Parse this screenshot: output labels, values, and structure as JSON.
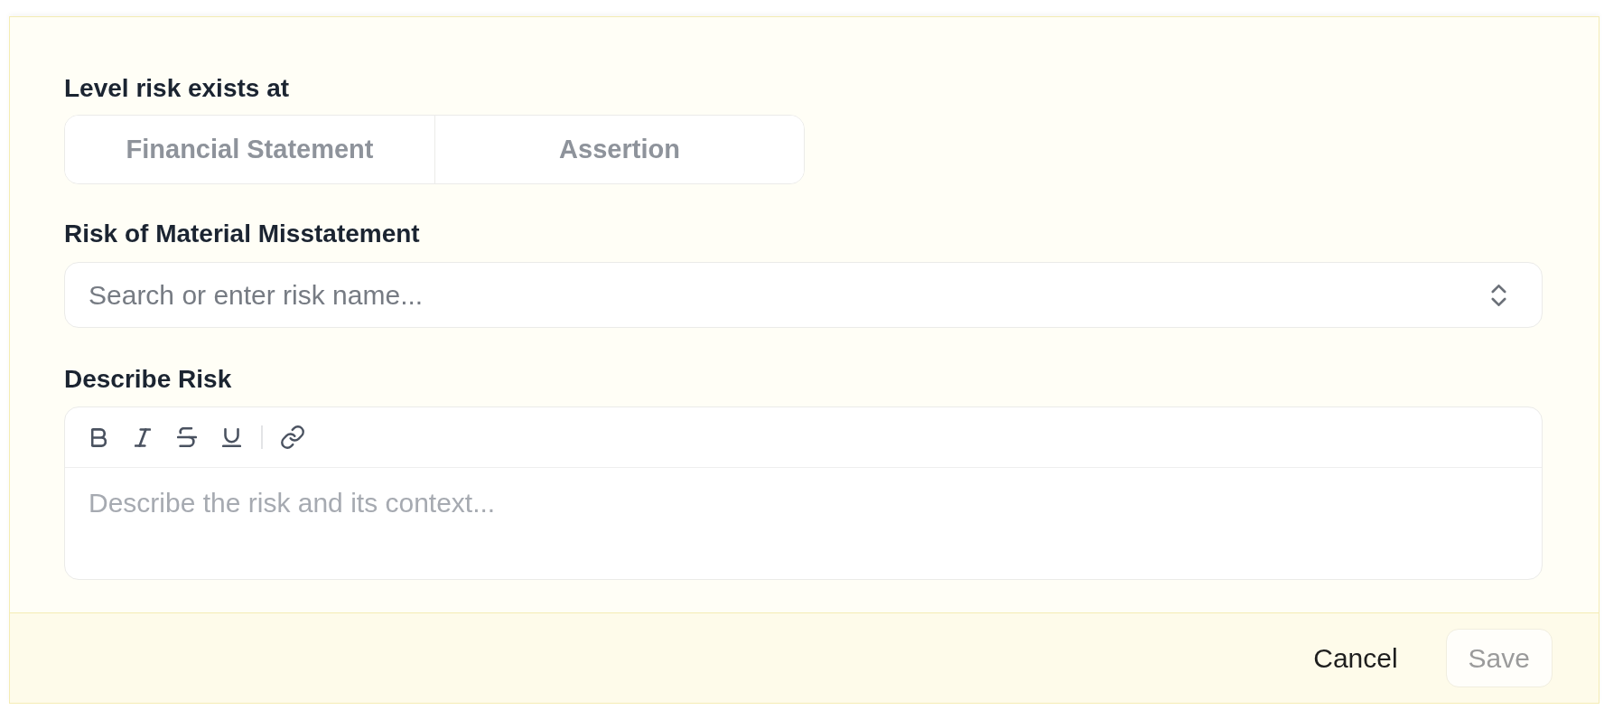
{
  "level_field": {
    "label": "Level risk exists at",
    "options": [
      {
        "label": "Financial Statement",
        "selected": false
      },
      {
        "label": "Assertion",
        "selected": false
      }
    ]
  },
  "risk_field": {
    "label": "Risk of Material Misstatement",
    "placeholder": "Search or enter risk name..."
  },
  "description_field": {
    "label": "Describe Risk",
    "placeholder": "Describe the risk and its context..."
  },
  "footer": {
    "buttons": [
      {
        "label": "Cancel",
        "kind": "text",
        "disabled": false
      },
      {
        "label": "Save",
        "kind": "outlined",
        "disabled": true
      }
    ]
  }
}
